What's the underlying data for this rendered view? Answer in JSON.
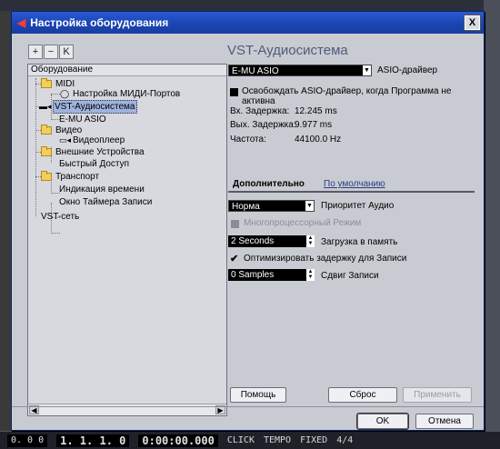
{
  "window": {
    "title": "Настройка оборудования",
    "close_glyph": "X"
  },
  "toolbar": {
    "add": "+",
    "remove": "−",
    "reset": "K"
  },
  "tree": {
    "header": "Оборудование",
    "items": [
      {
        "label": "MIDI"
      },
      {
        "label": "Настройка МИДИ-Портов"
      },
      {
        "label": "VST-Аудиосистема"
      },
      {
        "label": "E-MU ASIO"
      },
      {
        "label": "Видео"
      },
      {
        "label": "Видеоплеер"
      },
      {
        "label": "Внешние Устройства"
      },
      {
        "label": "Быстрый Доступ"
      },
      {
        "label": "Транспорт"
      },
      {
        "label": "Индикация времени"
      },
      {
        "label": "Окно Таймера Записи"
      },
      {
        "label": "VST-сеть"
      }
    ]
  },
  "panel": {
    "title": "VST-Аудиосистема",
    "driver": {
      "value": "E-MU ASIO",
      "label": "ASIO-драйвер"
    },
    "release_driver_label": "Освобождать ASIO-драйвер, когда Программа не активна",
    "stats": {
      "in_latency_label": "Вх. Задержка:",
      "in_latency_value": "12.245 ms",
      "out_latency_label": "Вых. Задержка:",
      "out_latency_value": "9.977 ms",
      "freq_label": "Частота:",
      "freq_value": "44100.0 Hz"
    },
    "tabs": {
      "advanced": "Дополнительно",
      "defaults": "По умолчанию"
    },
    "priority": {
      "value": "Норма",
      "label": "Приоритет Аудио"
    },
    "multiproc_label": "Многопроцессорный Режим",
    "preload": {
      "value": "2 Seconds",
      "label": "Загрузка в память"
    },
    "optimize_label": "Оптимизировать задержку для Записи",
    "record_shift": {
      "value": "0 Samples",
      "label": "Сдвиг Записи"
    }
  },
  "buttons": {
    "help": "Помощь",
    "reset": "Сброс",
    "apply": "Применить",
    "ok": "OK",
    "cancel": "Отмена"
  },
  "background_transport": {
    "time1": "1. 1. 1. 0",
    "time2": "0:00:00.000",
    "click": "CLICK",
    "tempo": "TEMPO",
    "fixed": "FIXED",
    "signature": "4/4",
    "left": "0. 0 0"
  }
}
